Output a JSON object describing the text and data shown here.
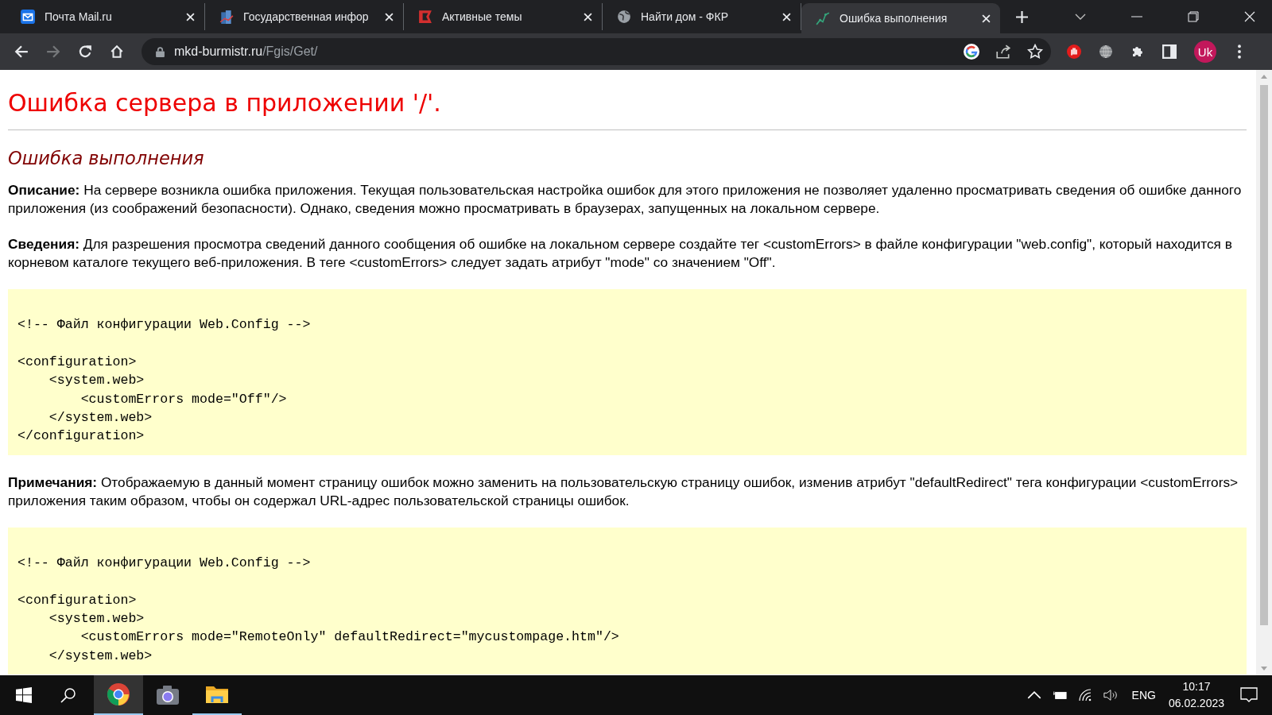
{
  "tabs": [
    {
      "kind": "mail",
      "title": "Почта Mail.ru",
      "selected": false
    },
    {
      "kind": "building",
      "title": "Государственная инфор",
      "selected": false
    },
    {
      "kind": "flag",
      "title": "Активные темы",
      "selected": false
    },
    {
      "kind": "globe",
      "title": "Найти дом - ФКР",
      "selected": false
    },
    {
      "kind": "chart",
      "title": "Ошибка выполнения",
      "selected": true
    }
  ],
  "address": {
    "host": "mkd-burmistr.ru",
    "path": "/Fgis/Get/"
  },
  "profile": {
    "initials": "Uk"
  },
  "page": {
    "title": "Ошибка сервера в приложении '/'.",
    "subtitle": "Ошибка выполнения",
    "sections": [
      {
        "kind": "text",
        "text": "**Описание:** На сервере возникла ошибка приложения. Текущая пользовательская настройка ошибок для этого приложения не позволяет удаленно просматривать сведения об ошибке данного приложения (из соображений безопасности). Однако, сведения можно просматривать в браузерах, запущенных на локальном сервере."
      },
      {
        "kind": "text",
        "text": "**Сведения:** Для разрешения просмотра сведений данного сообщения об ошибке на локальном сервере создайте тег <customErrors> в файле конфигурации \"web.config\", который находится в корневом каталоге текущего веб-приложения. В теге <customErrors> следует задать атрибут \"mode\" со значением \"Off\"."
      },
      {
        "kind": "code",
        "text": "<!-- Файл конфигурации Web.Config -->\n\n<configuration>\n    <system.web>\n        <customErrors mode=\"Off\"/>\n    </system.web>\n</configuration>"
      },
      {
        "kind": "text",
        "text": "**Примечания:** Отображаемую в данный момент страницу ошибок можно заменить на пользовательскую страницу ошибок, изменив атрибут \"defaultRedirect\" тега конфигурации <customErrors> приложения таким образом, чтобы он содержал URL-адрес пользовательской страницы ошибок."
      },
      {
        "kind": "code",
        "text": "<!-- Файл конфигурации Web.Config -->\n\n<configuration>\n    <system.web>\n        <customErrors mode=\"RemoteOnly\" defaultRedirect=\"mycustompage.htm\"/>\n    </system.web>"
      }
    ]
  },
  "taskbar": {
    "apps": [
      {
        "kind": "chrome",
        "running": true,
        "selected": true
      },
      {
        "kind": "camera",
        "running": false,
        "selected": false
      },
      {
        "kind": "folder",
        "running": true,
        "selected": false
      }
    ],
    "language": "ENG",
    "time": "10:17",
    "date": "06.02.2023"
  }
}
